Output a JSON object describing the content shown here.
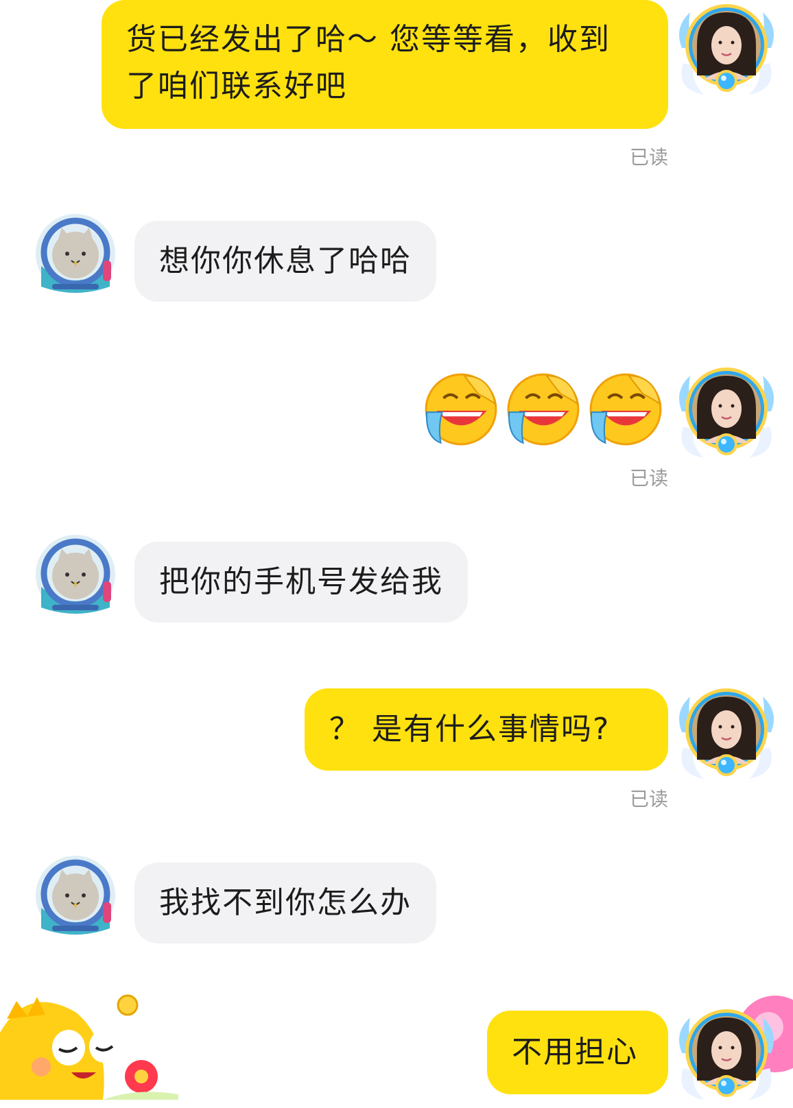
{
  "messages": [
    {
      "sender": "me",
      "text": "货已经发出了哈～ 您等等看，收到了咱们联系好吧",
      "line1": "货已经发出了哈～ 您等等看，收到",
      "line2": "了咱们联系好吧",
      "status": "已读"
    },
    {
      "sender": "other",
      "text": "想你你休息了哈哈"
    },
    {
      "sender": "me",
      "type": "emoji",
      "emoji": [
        "loudly-laughing-crying-face",
        "loudly-laughing-crying-face",
        "loudly-laughing-crying-face"
      ],
      "status": "已读"
    },
    {
      "sender": "other",
      "text": "把你的手机号发给我"
    },
    {
      "sender": "me",
      "text": "？ 是有什么事情吗?",
      "status": "已读"
    },
    {
      "sender": "other",
      "text": "我找不到你怎么办"
    },
    {
      "sender": "me",
      "text": "不用担心"
    }
  ],
  "avatars": {
    "me": "woman-portrait-avatar-with-winged-frame",
    "other": "cat-astronaut-avatar"
  },
  "colors": {
    "my_bubble": "#ffe10f",
    "other_bubble": "#f2f2f4",
    "read_status": "#9b9b9b"
  }
}
